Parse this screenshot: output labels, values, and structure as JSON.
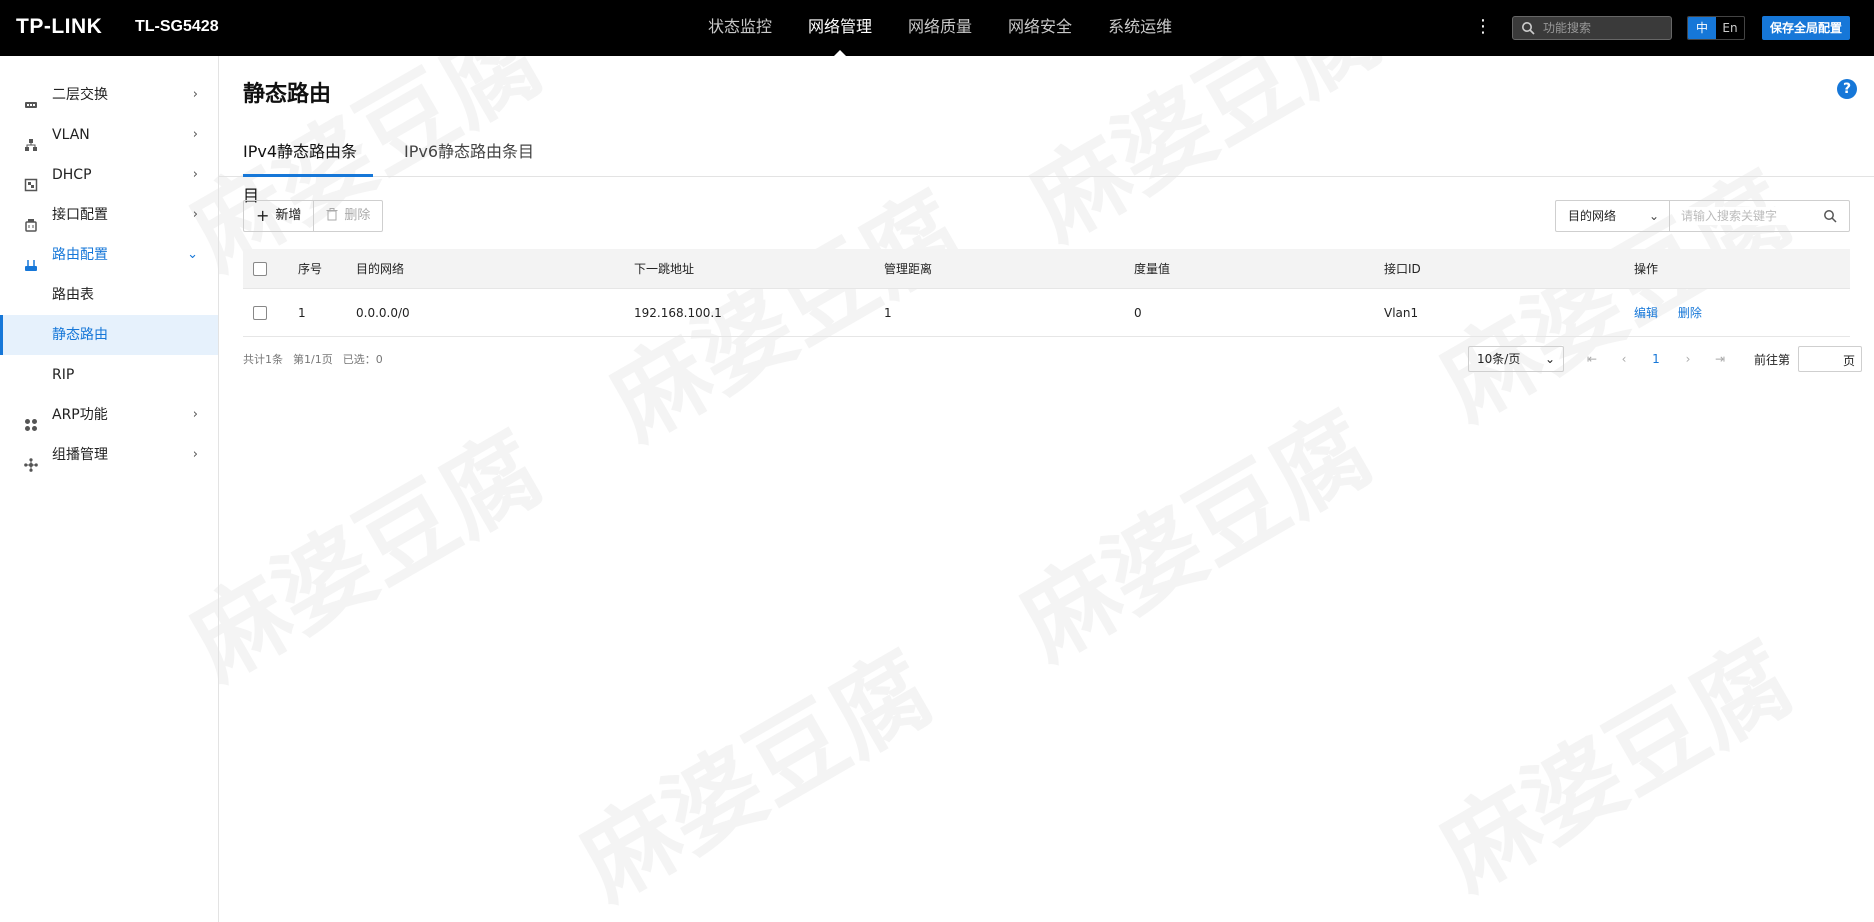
{
  "brand": {
    "logo": "TP-LINK",
    "model": "TL-SG5428"
  },
  "topnav": {
    "items": [
      "状态监控",
      "网络管理",
      "网络质量",
      "网络安全",
      "系统运维"
    ],
    "active_index": 1,
    "more_icon": "⋮",
    "search_placeholder": "功能搜索",
    "lang": {
      "zh": "中",
      "en": "En",
      "active": "zh"
    },
    "save_label": "保存全局配置"
  },
  "sidebar": {
    "items": [
      {
        "label": "二层交换",
        "icon": "switch-icon",
        "expanded": false
      },
      {
        "label": "VLAN",
        "icon": "vlan-tree-icon",
        "expanded": false
      },
      {
        "label": "DHCP",
        "icon": "dhcp-icon",
        "expanded": false
      },
      {
        "label": "接口配置",
        "icon": "interface-icon",
        "expanded": false
      },
      {
        "label": "路由配置",
        "icon": "router-icon",
        "expanded": true
      },
      {
        "label": "ARP功能",
        "icon": "arp-grid-icon",
        "expanded": false
      },
      {
        "label": "组播管理",
        "icon": "multicast-icon",
        "expanded": false
      }
    ],
    "sub_items": [
      "路由表",
      "静态路由",
      "RIP"
    ],
    "active_sub": "静态路由"
  },
  "page": {
    "title": "静态路由",
    "help": "?",
    "tabs": [
      "IPv4静态路由条目",
      "IPv6静态路由条目"
    ],
    "active_tab": 0,
    "add_label": "新增",
    "delete_label": "删除",
    "filter_field": "目的网络",
    "filter_placeholder": "请输入搜索关键字"
  },
  "table": {
    "columns": [
      "序号",
      "目的网络",
      "下一跳地址",
      "管理距离",
      "度量值",
      "接口ID",
      "操作"
    ],
    "rows": [
      {
        "idx": "1",
        "dest": "0.0.0.0/0",
        "next_hop": "192.168.100.1",
        "admin_distance": "1",
        "metric": "0",
        "interface": "Vlan1",
        "actions": [
          "编辑",
          "删除"
        ]
      }
    ]
  },
  "footer": {
    "total": "共计1条",
    "pages": "第1/1页",
    "selected": "已选：0",
    "page_size": "10条/页",
    "current_page": "1",
    "goto_label": "前往第",
    "goto_suffix": "页"
  },
  "watermark": "麻婆豆腐",
  "colors": {
    "accent": "#1677d8",
    "topbar": "#000000",
    "active_bg": "#e6f1fc"
  }
}
